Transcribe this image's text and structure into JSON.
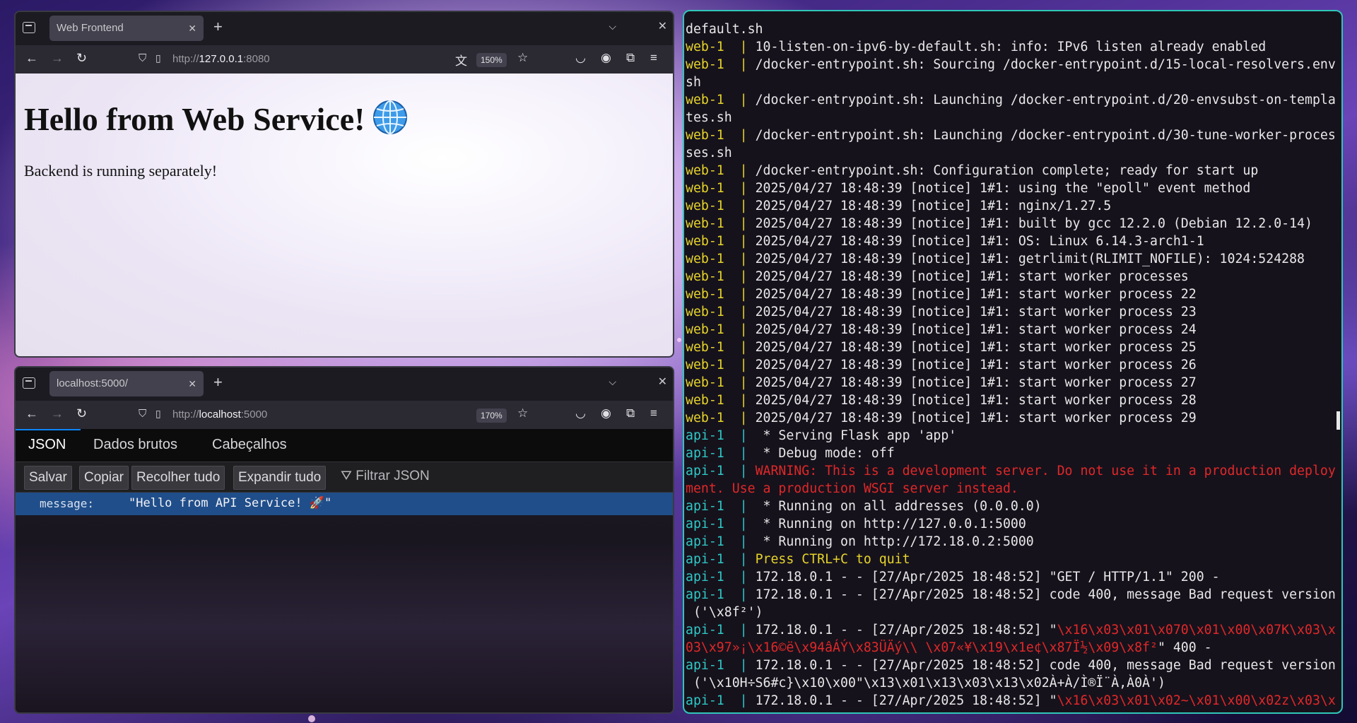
{
  "browser1": {
    "tab_title": "Web Frontend",
    "url_prefix": "http://",
    "url_host": "127.0.0.1",
    "url_suffix": ":8080",
    "zoom": "150%",
    "page": {
      "heading": "Hello from Web Service!",
      "text": "Backend is running separately!"
    }
  },
  "browser2": {
    "tab_title": "localhost:5000/",
    "url_prefix": "http://",
    "url_host": "localhost",
    "url_suffix": ":5000",
    "zoom": "170%",
    "tabs": [
      "JSON",
      "Dados brutos",
      "Cabeçalhos"
    ],
    "toolbar": {
      "save": "Salvar",
      "copy": "Copiar",
      "collapse": "Recolher tudo",
      "expand": "Expandir tudo",
      "filter": "Filtrar JSON"
    },
    "json_row": {
      "key": "message:",
      "value": "\"Hello from API Service! 🚀\""
    }
  },
  "terminal": {
    "lines": [
      {
        "p": "",
        "t": "default.sh"
      },
      {
        "p": "web-1  ",
        "t": "10-listen-on-ipv6-by-default.sh: info: IPv6 listen already enabled"
      },
      {
        "p": "web-1  ",
        "t": "/docker-entrypoint.sh: Sourcing /docker-entrypoint.d/15-local-resolvers.env"
      },
      {
        "p": "",
        "t": "sh"
      },
      {
        "p": "web-1  ",
        "t": "/docker-entrypoint.sh: Launching /docker-entrypoint.d/20-envsubst-on-templa"
      },
      {
        "p": "",
        "t": "tes.sh"
      },
      {
        "p": "web-1  ",
        "t": "/docker-entrypoint.sh: Launching /docker-entrypoint.d/30-tune-worker-proces"
      },
      {
        "p": "",
        "t": "ses.sh"
      },
      {
        "p": "web-1  ",
        "t": "/docker-entrypoint.sh: Configuration complete; ready for start up"
      },
      {
        "p": "web-1  ",
        "t": "2025/04/27 18:48:39 [notice] 1#1: using the \"epoll\" event method"
      },
      {
        "p": "web-1  ",
        "t": "2025/04/27 18:48:39 [notice] 1#1: nginx/1.27.5"
      },
      {
        "p": "web-1  ",
        "t": "2025/04/27 18:48:39 [notice] 1#1: built by gcc 12.2.0 (Debian 12.2.0-14)"
      },
      {
        "p": "web-1  ",
        "t": "2025/04/27 18:48:39 [notice] 1#1: OS: Linux 6.14.3-arch1-1"
      },
      {
        "p": "web-1  ",
        "t": "2025/04/27 18:48:39 [notice] 1#1: getrlimit(RLIMIT_NOFILE): 1024:524288"
      },
      {
        "p": "web-1  ",
        "t": "2025/04/27 18:48:39 [notice] 1#1: start worker processes"
      },
      {
        "p": "web-1  ",
        "t": "2025/04/27 18:48:39 [notice] 1#1: start worker process 22"
      },
      {
        "p": "web-1  ",
        "t": "2025/04/27 18:48:39 [notice] 1#1: start worker process 23"
      },
      {
        "p": "web-1  ",
        "t": "2025/04/27 18:48:39 [notice] 1#1: start worker process 24"
      },
      {
        "p": "web-1  ",
        "t": "2025/04/27 18:48:39 [notice] 1#1: start worker process 25"
      },
      {
        "p": "web-1  ",
        "t": "2025/04/27 18:48:39 [notice] 1#1: start worker process 26"
      },
      {
        "p": "web-1  ",
        "t": "2025/04/27 18:48:39 [notice] 1#1: start worker process 27"
      },
      {
        "p": "web-1  ",
        "t": "2025/04/27 18:48:39 [notice] 1#1: start worker process 28"
      },
      {
        "p": "web-1  ",
        "t": "2025/04/27 18:48:39 [notice] 1#1: start worker process 29"
      },
      {
        "p": "api-1  ",
        "t": " * Serving Flask app 'app'"
      },
      {
        "p": "api-1  ",
        "t": " * Debug mode: off"
      },
      {
        "p": "api-1  ",
        "t": "WARNING: This is a development server. Do not use it in a production deploy",
        "c": "red"
      },
      {
        "p": "",
        "t": "ment. Use a production WSGI server instead.",
        "c": "red"
      },
      {
        "p": "api-1  ",
        "t": " * Running on all addresses (0.0.0.0)"
      },
      {
        "p": "api-1  ",
        "t": " * Running on http://127.0.0.1:5000"
      },
      {
        "p": "api-1  ",
        "t": " * Running on http://172.18.0.2:5000"
      },
      {
        "p": "api-1  ",
        "t": "Press CTRL+C to quit",
        "c": "yel"
      },
      {
        "p": "api-1  ",
        "t": "172.18.0.1 - - [27/Apr/2025 18:48:52] \"GET / HTTP/1.1\" 200 -"
      },
      {
        "p": "api-1  ",
        "t": "172.18.0.1 - - [27/Apr/2025 18:48:52] code 400, message Bad request version"
      },
      {
        "p": "",
        "t": " ('\\x8f²')"
      },
      {
        "p": "api-1  ",
        "t": "172.18.0.1 - - [27/Apr/2025 18:48:52] \"",
        "r": "\\x16\\x03\\x01\\x070\\x01\\x00\\x07K\\x03\\x"
      },
      {
        "p": "",
        "t": "",
        "r": "03\\x97»¡\\x16©ë\\x94âÁÝ\\x83ÜÄý\\\\ \\x07«¥\\x19\\x1e¢\\x87Ï½\\x09\\x8f²",
        "tail": "\" 400 -"
      },
      {
        "p": "api-1  ",
        "t": "172.18.0.1 - - [27/Apr/2025 18:48:52] code 400, message Bad request version"
      },
      {
        "p": "",
        "t": " ('\\x10H÷S6#c}\\x10\\x00\"\\x13\\x01\\x13\\x03\\x13\\x02À+À/Ì®Ï¨À,À0À')"
      },
      {
        "p": "api-1  ",
        "t": "172.18.0.1 - - [27/Apr/2025 18:48:52] \"",
        "r": "\\x16\\x03\\x01\\x02~\\x01\\x00\\x02z\\x03\\x"
      }
    ]
  }
}
